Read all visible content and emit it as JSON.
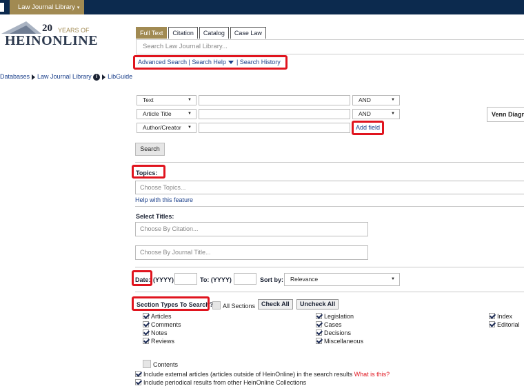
{
  "topbar": {
    "library_tab": "Law Journal Library",
    "library_caret": "▾"
  },
  "logo": {
    "years_number": "20",
    "years_of": "YEARS OF",
    "brand": "HEINONLINE"
  },
  "tabs": [
    "Full Text",
    "Citation",
    "Catalog",
    "Case Law"
  ],
  "search": {
    "placeholder": "Search Law Journal Library..."
  },
  "adv_links": {
    "advanced": "Advanced Search",
    "sep1": " | ",
    "help": "Search Help",
    "sep2": " | ",
    "history": "Search History"
  },
  "breadcrumb": {
    "databases": "Databases",
    "library": "Law Journal Library",
    "libguide": "LibGuide"
  },
  "fields": [
    {
      "field": "Text",
      "operator": "AND"
    },
    {
      "field": "Article Title",
      "operator": "AND"
    },
    {
      "field": "Author/Creator"
    }
  ],
  "add_field": "Add field",
  "venn": "Venn Diagram",
  "search_button": "Search",
  "topics": {
    "label": "Topics:",
    "placeholder": "Choose Topics...",
    "help": "Help with this feature"
  },
  "titles": {
    "label": "Select Titles:",
    "citation_placeholder": "Choose By Citation...",
    "journal_placeholder": "Choose By Journal Title..."
  },
  "date": {
    "label": "Date:",
    "from": "(YYYY)",
    "to_label": "To: (YYYY)",
    "sort_label": "Sort by:",
    "sort_value": "Relevance"
  },
  "sections": {
    "label": "Section Types To Search?",
    "all_sections": "All Sections",
    "check_all": "Check All",
    "uncheck_all": "Uncheck All",
    "col1": [
      "Articles",
      "Comments",
      "Notes",
      "Reviews"
    ],
    "col2": [
      "Legislation",
      "Cases",
      "Decisions",
      "Miscellaneous"
    ],
    "col3": [
      "Index",
      "Editorial"
    ],
    "contents": "Contents"
  },
  "include": {
    "external": "Include external articles (articles outside of HeinOnline) in the search results",
    "what_is_this": "What is this?",
    "periodical": "Include periodical results from other HeinOnline Collections"
  },
  "colors": {
    "navy": "#0c2a4e",
    "gold": "#a18a52",
    "link": "#1a3f8a",
    "highlight": "#e0141e"
  }
}
